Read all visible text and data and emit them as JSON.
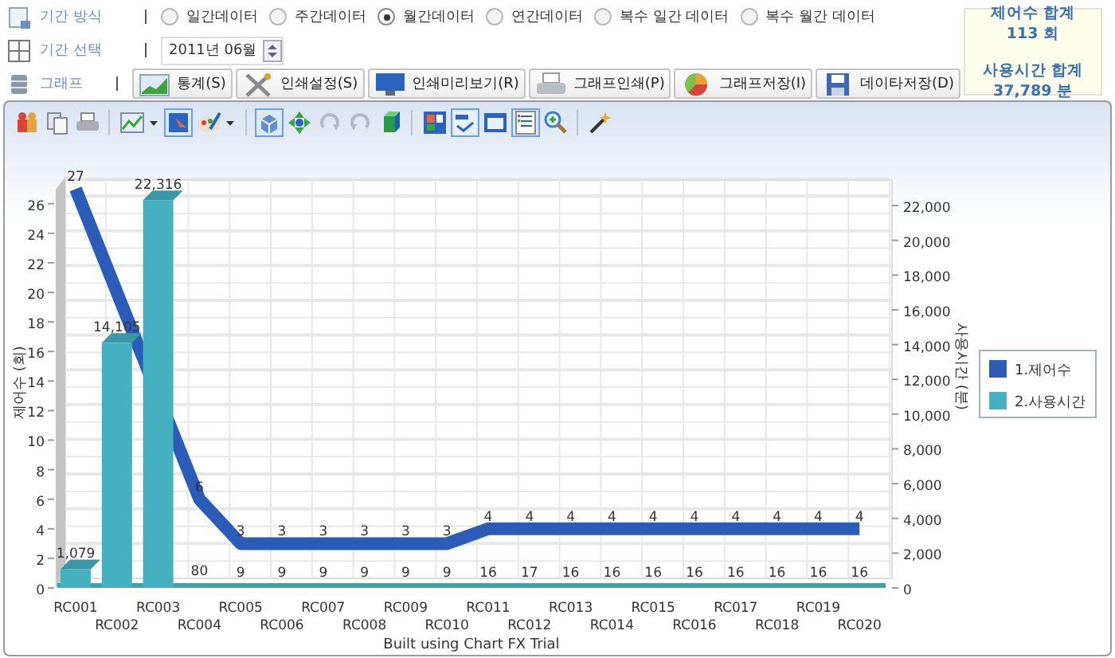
{
  "filters": [
    {
      "label": "기간 방식",
      "kind": "radio",
      "options": [
        {
          "label": "일간데이터",
          "selected": false
        },
        {
          "label": "주간데이터",
          "selected": false
        },
        {
          "label": "월간데이터",
          "selected": true
        },
        {
          "label": "연간데이터",
          "selected": false
        },
        {
          "label": "복수 일간 데이터",
          "selected": false
        },
        {
          "label": "복수 월간 데이터",
          "selected": false
        }
      ]
    },
    {
      "label": "기간 선택",
      "kind": "spinner",
      "value": "2011년 06월"
    },
    {
      "label": "그래프",
      "kind": "buttons",
      "buttons": [
        "통계(S)",
        "인쇄설정(S)",
        "인쇄미리보기(R)",
        "그래프인쇄(P)",
        "그래프저장(I)",
        "데이타저장(D)"
      ]
    }
  ],
  "summary": [
    {
      "title": "제어수 합계",
      "value": "113 회"
    },
    {
      "title": "사용시간 합계",
      "value": "37,789 분"
    }
  ],
  "toolbar": [
    [
      {
        "selected": false,
        "disabled": false,
        "dropdown": false
      },
      {
        "selected": false,
        "disabled": false,
        "dropdown": false
      },
      {
        "selected": false,
        "disabled": false,
        "dropdown": false
      }
    ],
    [
      {
        "selected": false,
        "disabled": false,
        "dropdown": true
      },
      {
        "selected": true,
        "disabled": false,
        "dropdown": false
      },
      {
        "selected": false,
        "disabled": false,
        "dropdown": true
      }
    ],
    [
      {
        "selected": true,
        "disabled": false,
        "dropdown": false
      },
      {
        "selected": false,
        "disabled": false,
        "dropdown": false
      },
      {
        "selected": false,
        "disabled": true,
        "dropdown": false
      },
      {
        "selected": false,
        "disabled": true,
        "dropdown": false
      },
      {
        "selected": false,
        "disabled": false,
        "dropdown": false
      }
    ],
    [
      {
        "selected": false,
        "disabled": false,
        "dropdown": false
      },
      {
        "selected": true,
        "disabled": false,
        "dropdown": false
      },
      {
        "selected": false,
        "disabled": false,
        "dropdown": false
      },
      {
        "selected": true,
        "disabled": false,
        "dropdown": false
      },
      {
        "selected": false,
        "disabled": false,
        "dropdown": false
      }
    ],
    [
      {
        "selected": false,
        "disabled": false,
        "dropdown": false
      }
    ]
  ],
  "chart": {
    "chart_data": {
      "type": "bar",
      "categories": [
        "RC001",
        "RC002",
        "RC003",
        "RC004",
        "RC005",
        "RC006",
        "RC007",
        "RC008",
        "RC009",
        "RC010",
        "RC011",
        "RC012",
        "RC013",
        "RC014",
        "RC015",
        "RC016",
        "RC017",
        "RC018",
        "RC019",
        "RC020"
      ],
      "series": [
        {
          "name": "1.제어수",
          "color": "#2a5cb8",
          "type": "line",
          "values": [
            27,
            null,
            null,
            6,
            3,
            3,
            3,
            3,
            3,
            3,
            4,
            4,
            4,
            4,
            4,
            4,
            4,
            4,
            4,
            4
          ]
        },
        {
          "name": "2.사용시간",
          "color": "#45b0c0",
          "axis": "y2",
          "values": [
            1079,
            14105,
            22316,
            80,
            9,
            9,
            9,
            9,
            9,
            9,
            16,
            17,
            16,
            16,
            16,
            16,
            16,
            16,
            16,
            16
          ]
        }
      ],
      "grid": true,
      "legend": "right",
      "ylabel": "제어수 (회)",
      "y2label": "사용시간 (분)",
      "ylim": [
        0,
        27.6
      ],
      "y2lim": [
        0,
        23470
      ],
      "yticks": [
        0,
        2,
        4,
        6,
        8,
        10,
        12,
        14,
        16,
        18,
        20,
        22,
        24,
        26
      ],
      "y2ticks": [
        {
          "value": 0,
          "label": "0"
        },
        {
          "value": 2000,
          "label": "2,000"
        },
        {
          "value": 4000,
          "label": "4,000"
        },
        {
          "value": 6000,
          "label": "6,000"
        },
        {
          "value": 8000,
          "label": "8,000"
        },
        {
          "value": 10000,
          "label": "10,000"
        },
        {
          "value": 12000,
          "label": "12,000"
        },
        {
          "value": 14000,
          "label": "14,000"
        },
        {
          "value": 16000,
          "label": "16,000"
        },
        {
          "value": 18000,
          "label": "18,000"
        },
        {
          "value": 20000,
          "label": "20,000"
        },
        {
          "value": 22000,
          "label": "22,000"
        }
      ],
      "value_labels": [
        [
          "27",
          null,
          null,
          "6",
          "3",
          "3",
          "3",
          "3",
          "3",
          "3",
          "4",
          "4",
          "4",
          "4",
          "4",
          "4",
          "4",
          "4",
          "4",
          "4"
        ],
        [
          "1,079",
          "14,105",
          "22,316",
          "80",
          "9",
          "9",
          "9",
          "9",
          "9",
          "9",
          "16",
          "17",
          "16",
          "16",
          "16",
          "16",
          "16",
          "16",
          "16",
          "16"
        ]
      ]
    },
    "footer": "Built using Chart FX Trial"
  }
}
